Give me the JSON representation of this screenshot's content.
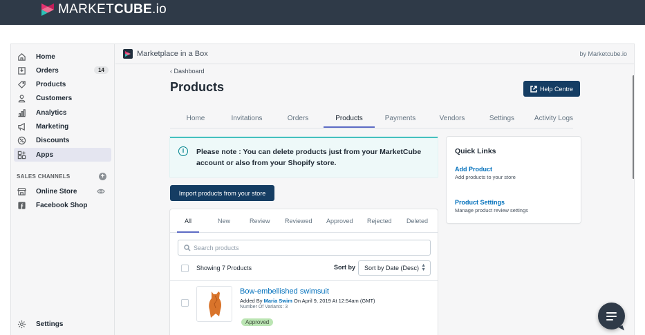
{
  "brand": {
    "name_light": "MARKET",
    "name_bold": "CUBE",
    "name_suffix": ".io"
  },
  "sidebar": {
    "items": [
      {
        "label": "Home",
        "icon": "home-icon"
      },
      {
        "label": "Orders",
        "icon": "orders-icon",
        "badge": "14"
      },
      {
        "label": "Products",
        "icon": "tag-icon"
      },
      {
        "label": "Customers",
        "icon": "customer-icon"
      },
      {
        "label": "Analytics",
        "icon": "analytics-icon"
      },
      {
        "label": "Marketing",
        "icon": "megaphone-icon"
      },
      {
        "label": "Discounts",
        "icon": "discount-icon"
      },
      {
        "label": "Apps",
        "icon": "apps-icon",
        "active": true
      }
    ],
    "sales_channels_heading": "SALES CHANNELS",
    "channels": [
      {
        "label": "Online Store",
        "icon": "store-icon"
      },
      {
        "label": "Facebook Shop",
        "icon": "facebook-icon"
      }
    ],
    "settings_label": "Settings"
  },
  "appbar": {
    "title": "Marketplace in a Box",
    "by": "by Marketcube.io"
  },
  "page": {
    "back_label": "Dashboard",
    "title": "Products",
    "help_label": "Help Centre"
  },
  "tabs": [
    "Home",
    "Invitations",
    "Orders",
    "Products",
    "Payments",
    "Vendors",
    "Settings",
    "Activity Logs"
  ],
  "active_tab": "Products",
  "notice": {
    "text": "Please note : You can delete products just from your MarketCube account or also from your Shopify store."
  },
  "import_label": "Import products from your store",
  "quick_links": {
    "title": "Quick Links",
    "links": [
      {
        "label": "Add Product",
        "desc": "Add products to your store"
      },
      {
        "label": "Product Settings",
        "desc": "Manage product review settings"
      }
    ]
  },
  "product_tabs": [
    "All",
    "New",
    "Review",
    "Reviewed",
    "Approved",
    "Rejected",
    "Deleted"
  ],
  "search": {
    "placeholder": "Search products",
    "value": ""
  },
  "list": {
    "showing": "Showing 7 Products",
    "sort_by_label": "Sort by",
    "sort_value": "Sort by Date (Desc)"
  },
  "products": [
    {
      "name": "Bow-embellished swimsuit",
      "added_by_prefix": "Added By",
      "author": "Maria Swim",
      "added_on": "On April 9, 2019 At 12:54am (GMT)",
      "variants": "Number Of Variants: 3",
      "status": "Approved"
    }
  ],
  "colors": {
    "topbar": "#2f3a48",
    "primary_button": "#153d63",
    "tab_underline": "#5c6ac4",
    "link": "#006fbb",
    "approved_badge": "#bbe5b3",
    "notice_border": "#47c1bf",
    "logo_pink": "#e5306f",
    "logo_teal": "#2cc2b7"
  }
}
